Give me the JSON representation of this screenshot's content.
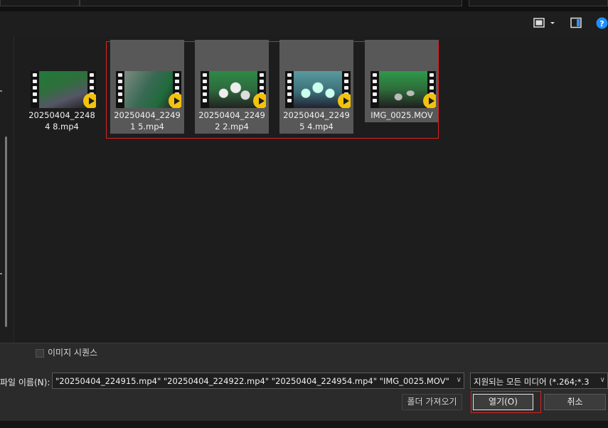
{
  "toolbar": {
    "view_icon": "thumbnail-view-icon",
    "dropdown_icon": "chevron-down-icon",
    "preview_icon": "preview-pane-icon",
    "help_label": "?"
  },
  "files": [
    {
      "name": "20250404_224848.mp4",
      "display": "20250404_22484 8.mp4",
      "selected": false,
      "thumb_color": "#2f6f3c"
    },
    {
      "name": "20250404_224915.mp4",
      "display": "20250404_22491 5.mp4",
      "selected": true,
      "thumb_color": "#3a6a55"
    },
    {
      "name": "20250404_224922.mp4",
      "display": "20250404_22492 2.mp4",
      "selected": true,
      "thumb_color": "#2e6a3e"
    },
    {
      "name": "20250404_224954.mp4",
      "display": "20250404_22495 4.mp4",
      "selected": true,
      "thumb_color": "#3d6f78"
    },
    {
      "name": "IMG_0025.MOV",
      "display": "IMG_0025.MOV",
      "selected": true,
      "thumb_color": "#2f6a3a"
    }
  ],
  "image_sequence_label": "이미지 시퀀스",
  "file_name_label": "파일 이름(N):",
  "file_name_value": "\"20250404_224915.mp4\" \"20250404_224922.mp4\" \"20250404_224954.mp4\" \"IMG_0025.MOV\"",
  "file_type_value": "지원되는 모든 미디어 (*.264;*.3",
  "buttons": {
    "import_folder": "폴더 가져오기",
    "open": "열기(O)",
    "cancel": "취소"
  },
  "colors": {
    "highlight": "#e02020",
    "play_badge": "#f2c20d",
    "help_blue": "#1e90ff"
  }
}
